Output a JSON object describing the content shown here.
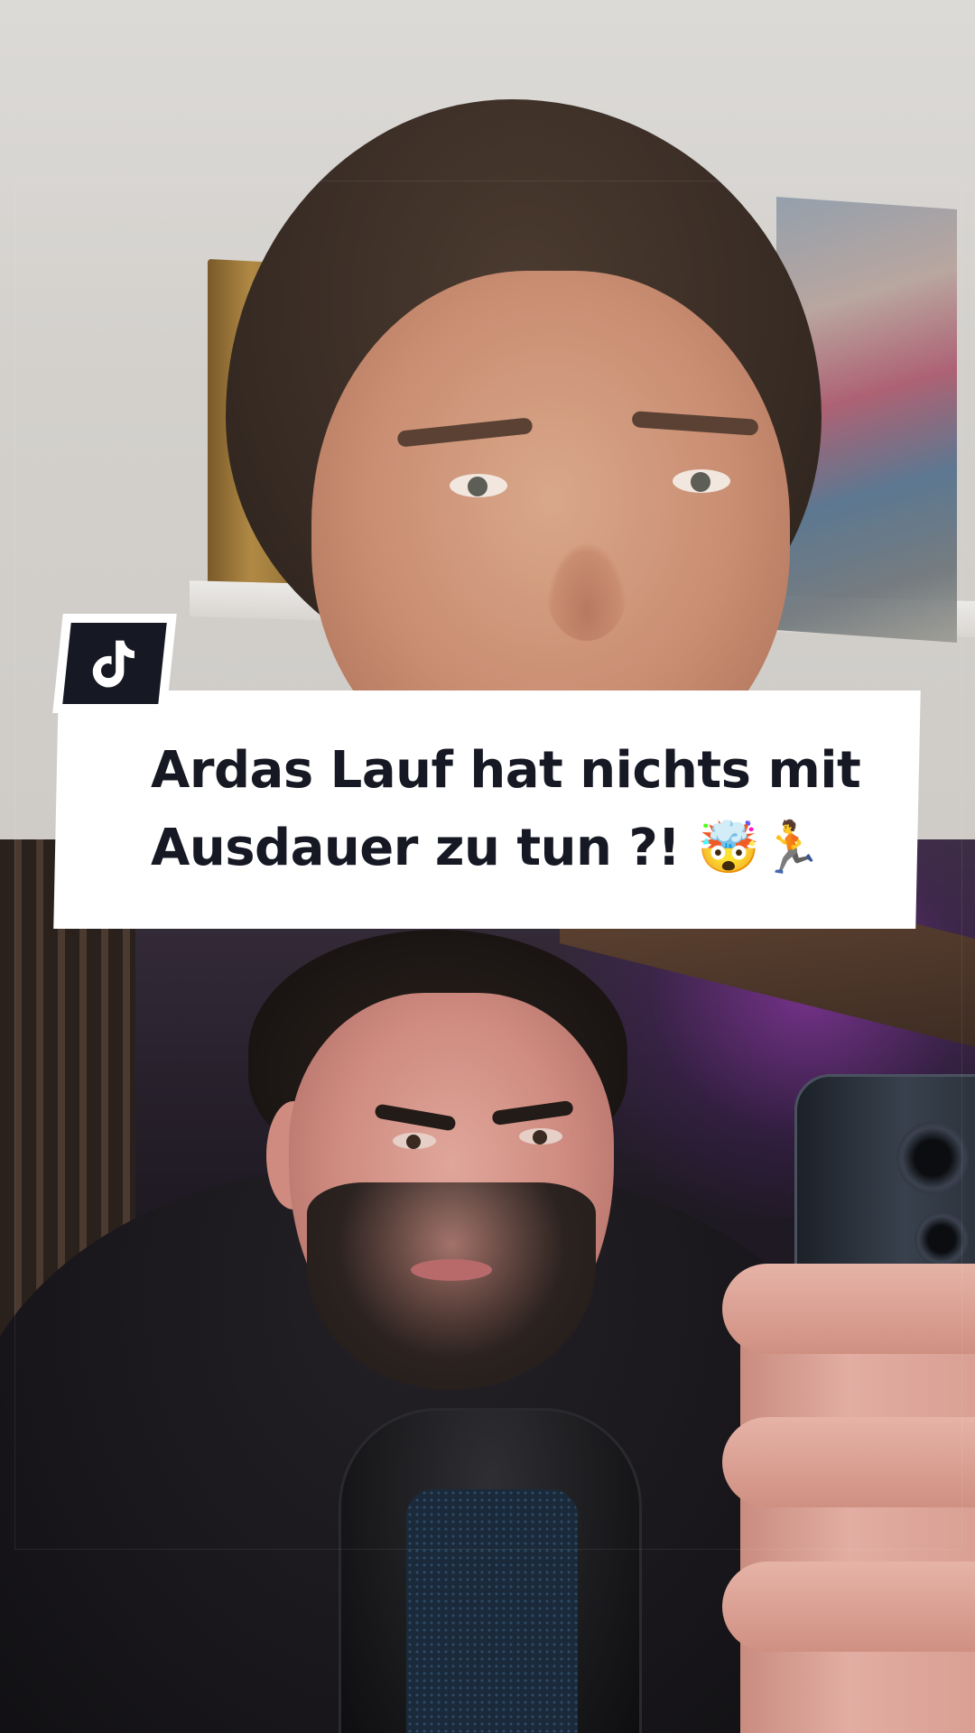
{
  "caption": {
    "line1": "Ardas Lauf hat nichts mit",
    "line2": "Ausdauer zu tun ?! 🤯🏃"
  },
  "badge": {
    "icon": "tiktok-logo-icon"
  },
  "colors": {
    "caption_text": "#161823",
    "card_background": "#ffffff",
    "badge_background": "#161823"
  }
}
